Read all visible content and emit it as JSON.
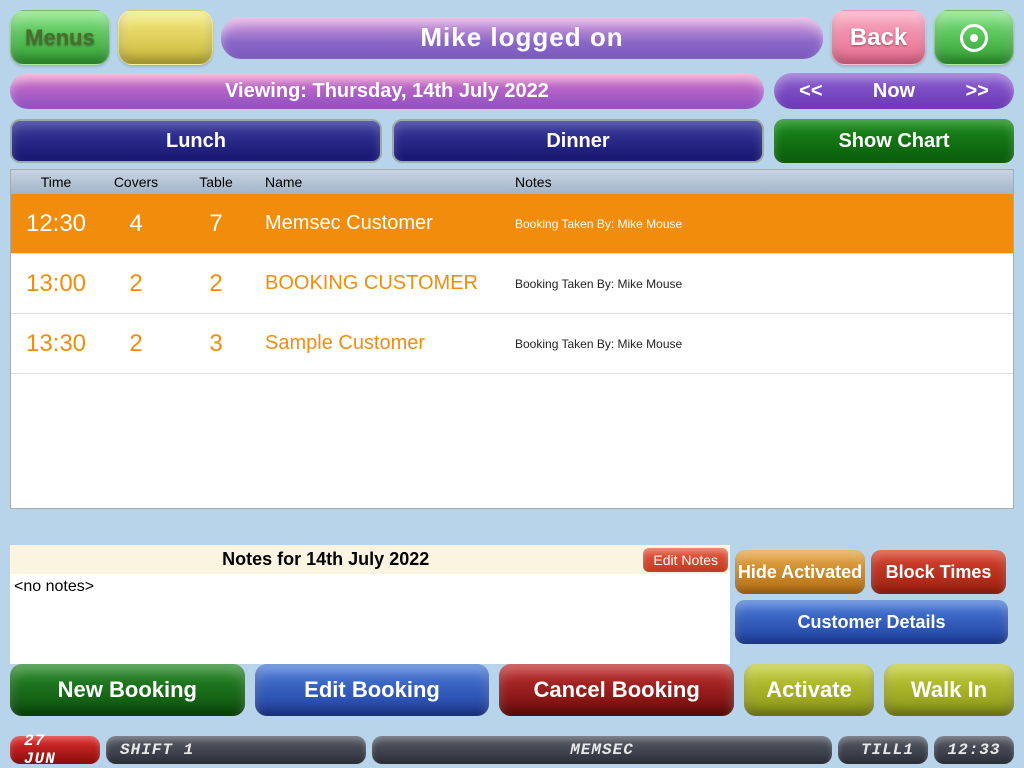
{
  "header": {
    "menus": "Menus",
    "title": "Mike logged on",
    "back": "Back"
  },
  "row2": {
    "viewing": "Viewing: Thursday, 14th July 2022",
    "prev": "<<",
    "now": "Now",
    "next": ">>"
  },
  "sessions": {
    "lunch": "Lunch",
    "dinner": "Dinner",
    "chart": "Show Chart"
  },
  "table": {
    "headers": {
      "time": "Time",
      "covers": "Covers",
      "table": "Table",
      "name": "Name",
      "notes": "Notes"
    },
    "rows": [
      {
        "time": "12:30",
        "covers": "4",
        "table": "7",
        "name": "Memsec Customer",
        "notes": "Booking Taken By: Mike Mouse",
        "selected": true
      },
      {
        "time": "13:00",
        "covers": "2",
        "table": "2",
        "name": "BOOKING CUSTOMER",
        "notes": "Booking Taken By: Mike Mouse",
        "selected": false
      },
      {
        "time": "13:30",
        "covers": "2",
        "table": "3",
        "name": "Sample Customer",
        "notes": "Booking Taken By: Mike Mouse",
        "selected": false
      }
    ]
  },
  "notes": {
    "title": "Notes for 14th July 2022",
    "edit": "Edit Notes",
    "body": "<no notes>"
  },
  "right": {
    "hide": "Hide Activated",
    "block": "Block Times",
    "cust": "Customer Details"
  },
  "bottom": {
    "newb": "New Booking",
    "editb": "Edit Booking",
    "cancelb": "Cancel Booking",
    "activate": "Activate",
    "walkin": "Walk In"
  },
  "status": {
    "date": "27 JUN",
    "shift": "SHIFT 1",
    "brand": "MEMSEC",
    "till": "TILL1",
    "time": "12:33"
  }
}
